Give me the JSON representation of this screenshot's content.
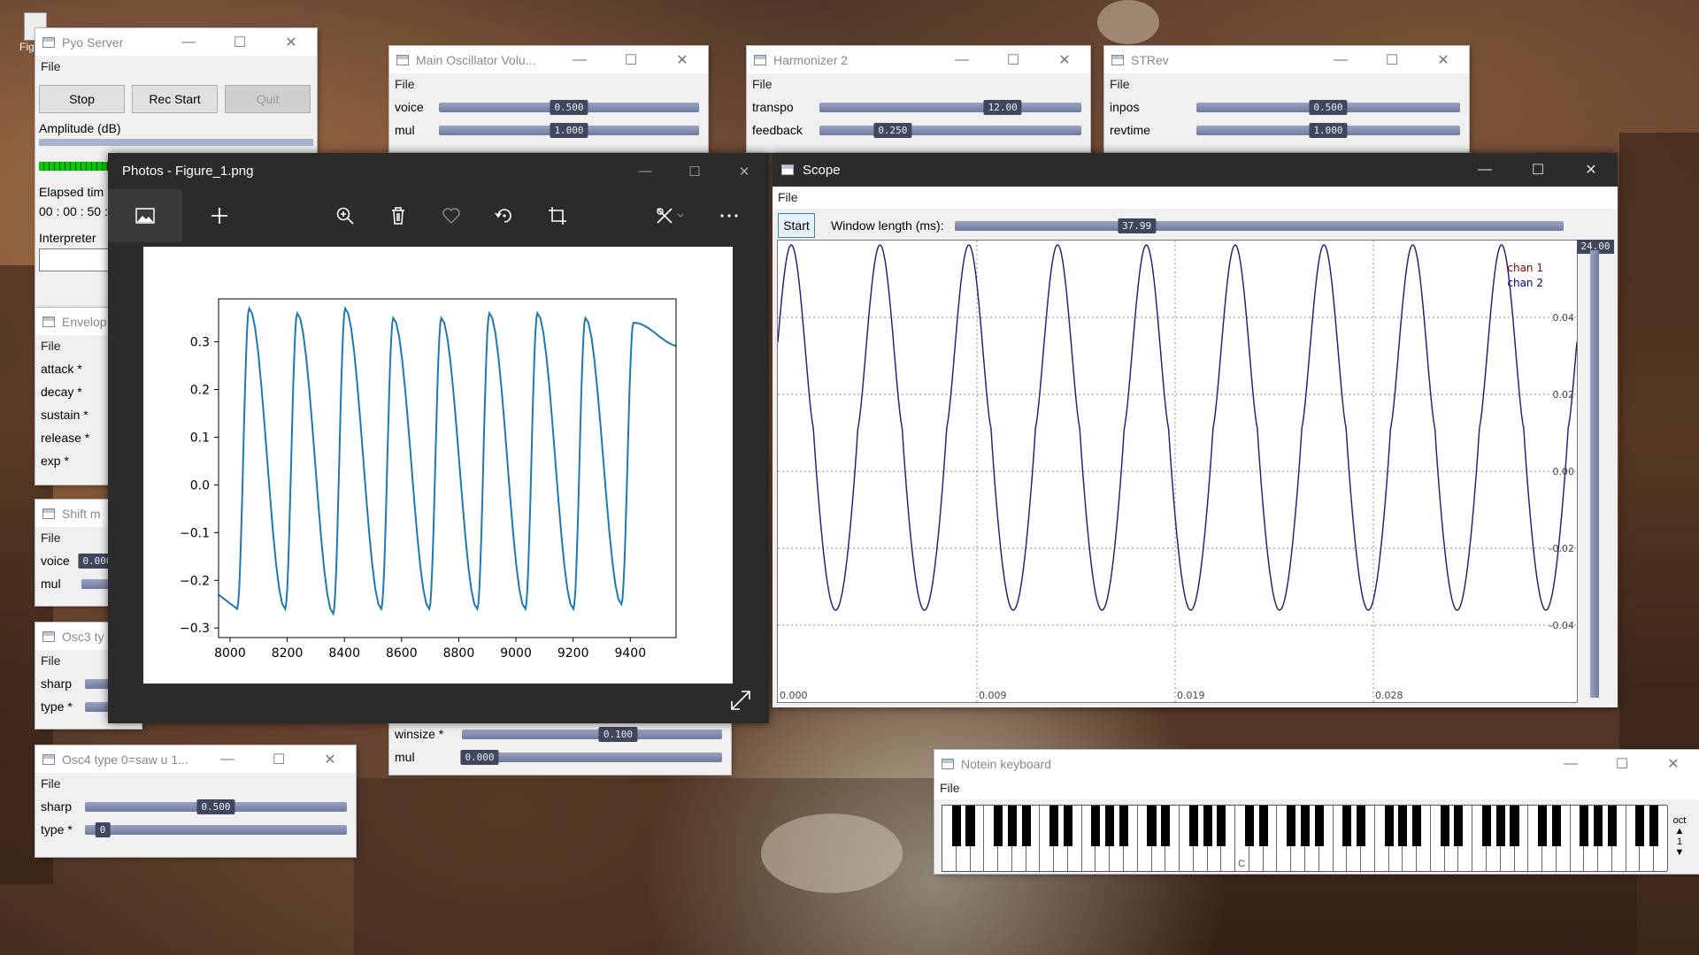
{
  "desktop": {
    "icon_label": "Fig"
  },
  "server": {
    "title": "Pyo Server",
    "menu": "File",
    "stop": "Stop",
    "rec_start": "Rec Start",
    "quit": "Quit",
    "amplitude_label": "Amplitude (dB)",
    "elapsed_label": "Elapsed tim",
    "elapsed_value": "00 : 00 : 50 :",
    "interpreter_label": "Interpreter"
  },
  "main_osc": {
    "title": "Main Oscillator Volu...",
    "menu": "File",
    "rows": [
      {
        "label": "voice",
        "value": "0.500",
        "level": 0.5
      },
      {
        "label": "mul",
        "value": "1.000",
        "level": 0.5
      }
    ]
  },
  "harmonizer": {
    "title": "Harmonizer 2",
    "menu": "File",
    "rows": [
      {
        "label": "transpo",
        "value": "12.00",
        "level": 0.7
      },
      {
        "label": "feedback",
        "value": "0.250",
        "level": 0.28
      }
    ]
  },
  "strev": {
    "title": "STRev",
    "menu": "File",
    "rows": [
      {
        "label": "inpos",
        "value": "0.500",
        "level": 0.5
      },
      {
        "label": "revtime",
        "value": "1.000",
        "level": 0.5
      }
    ]
  },
  "envelope": {
    "title": "Envelop",
    "menu": "File",
    "rows": [
      "attack *",
      "decay *",
      "sustain *",
      "release *",
      "exp *"
    ]
  },
  "shift": {
    "title": "Shift m",
    "menu": "File",
    "rows": [
      {
        "label": "voice",
        "value": "0.000"
      },
      {
        "label": "mul",
        "value": ""
      }
    ]
  },
  "osc3": {
    "title": "Osc3 ty",
    "menu": "File",
    "rows": [
      "sharp",
      "type *"
    ]
  },
  "osc4": {
    "title": "Osc4 type 0=saw u 1...",
    "menu": "File",
    "rows": [
      {
        "label": "sharp",
        "value": "0.500",
        "level": 0.5
      },
      {
        "label": "type *",
        "value": "0",
        "level": 0.02
      }
    ]
  },
  "chorus": {
    "rows": [
      {
        "label": "winsize *",
        "value": "0.100",
        "level": 0.6
      },
      {
        "label": "mul",
        "value": "0.000",
        "level": 0.02
      }
    ]
  },
  "photos": {
    "title": "Photos - Figure_1.png",
    "toolbar": [
      "image-icon",
      "plus-icon",
      "zoom-icon",
      "trash-icon",
      "heart-icon",
      "rotate-icon",
      "crop-icon",
      "edit-icon",
      "more-icon"
    ]
  },
  "chart_data": {
    "type": "line",
    "title": "",
    "xlabel": "",
    "ylabel": "",
    "xlim": [
      7960,
      9560
    ],
    "ylim": [
      -0.32,
      0.39
    ],
    "xticks": [
      8000,
      8200,
      8400,
      8600,
      8800,
      9000,
      9200,
      9400
    ],
    "xtick_labels": [
      "8000",
      "8200",
      "8400",
      "8600",
      "8800",
      "9000",
      "9200",
      "9400"
    ],
    "yticks": [
      -0.3,
      -0.2,
      -0.1,
      0.0,
      0.1,
      0.2,
      0.3
    ],
    "ytick_labels": [
      "−0.3",
      "−0.2",
      "−0.1",
      "0.0",
      "0.1",
      "0.2",
      "0.3"
    ],
    "period": 168,
    "peaks": [
      {
        "x": 8067,
        "y": 0.37
      },
      {
        "x": 8235,
        "y": 0.36
      },
      {
        "x": 8403,
        "y": 0.37
      },
      {
        "x": 8571,
        "y": 0.35
      },
      {
        "x": 8739,
        "y": 0.35
      },
      {
        "x": 8907,
        "y": 0.36
      },
      {
        "x": 9075,
        "y": 0.36
      },
      {
        "x": 9243,
        "y": 0.35
      },
      {
        "x": 9411,
        "y": 0.34
      }
    ],
    "troughs": [
      {
        "x": 8025,
        "y": -0.26
      },
      {
        "x": 8193,
        "y": -0.26
      },
      {
        "x": 8361,
        "y": -0.27
      },
      {
        "x": 8529,
        "y": -0.26
      },
      {
        "x": 8697,
        "y": -0.26
      },
      {
        "x": 8865,
        "y": -0.26
      },
      {
        "x": 9033,
        "y": -0.26
      },
      {
        "x": 9201,
        "y": -0.26
      },
      {
        "x": 9369,
        "y": -0.25
      }
    ],
    "color": "#1f77b4"
  },
  "scope": {
    "title": "Scope",
    "menu": "File",
    "start": "Start",
    "window_label": "Window length (ms):",
    "window_value": "37.99",
    "gain_value": "24.00",
    "legend": [
      {
        "name": "chan 1",
        "color": "#8b0000"
      },
      {
        "name": "chan 2",
        "color": "#00008b"
      }
    ],
    "xtick_labels": [
      "0.000",
      "0.009",
      "0.019",
      "0.028"
    ],
    "ytick_labels": [
      "0.04",
      "0.02",
      "0.00",
      "-0.02",
      "-0.04"
    ],
    "cycles": 9,
    "amplitude_top": 0.059,
    "amplitude_bottom": -0.04
  },
  "keyboard": {
    "title": "Notein keyboard",
    "menu": "File",
    "octave_label": "oct",
    "octave_value": "1",
    "c_label": "C",
    "white_keys": 52
  }
}
